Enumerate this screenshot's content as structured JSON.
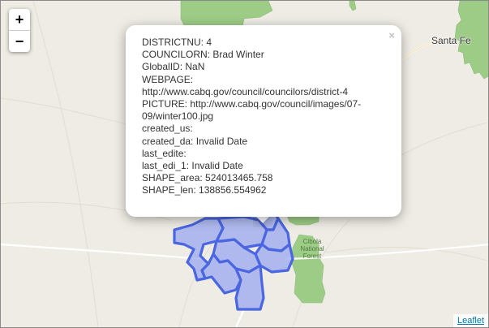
{
  "map": {
    "zoom_in_label": "+",
    "zoom_out_label": "−",
    "attribution": "Leaflet",
    "places": [
      {
        "key": "santa_fe",
        "label": "Santa Fe"
      }
    ],
    "forest_label_lines": [
      "Cibola",
      "National",
      "Forest"
    ],
    "colors": {
      "land": "#eeece4",
      "forest": "#9ccc86",
      "district_fill": "#9aa8f2",
      "district_stroke": "#4a66e0",
      "road": "#ffffff"
    }
  },
  "popup": {
    "close_icon": "×",
    "lines": [
      "DISTRICTNU: 4",
      "COUNCILORN: Brad Winter",
      "GlobalID: NaN",
      "WEBPAGE:",
      "http://www.cabq.gov/council/councilors/district-4",
      "PICTURE: http://www.cabq.gov/council/images/07-09/winter100.jpg",
      "created_us:",
      "created_da: Invalid Date",
      "last_edite:",
      "last_edi_1: Invalid Date",
      "SHAPE_area: 524013465.758",
      "SHAPE_len: 138856.554962"
    ]
  }
}
